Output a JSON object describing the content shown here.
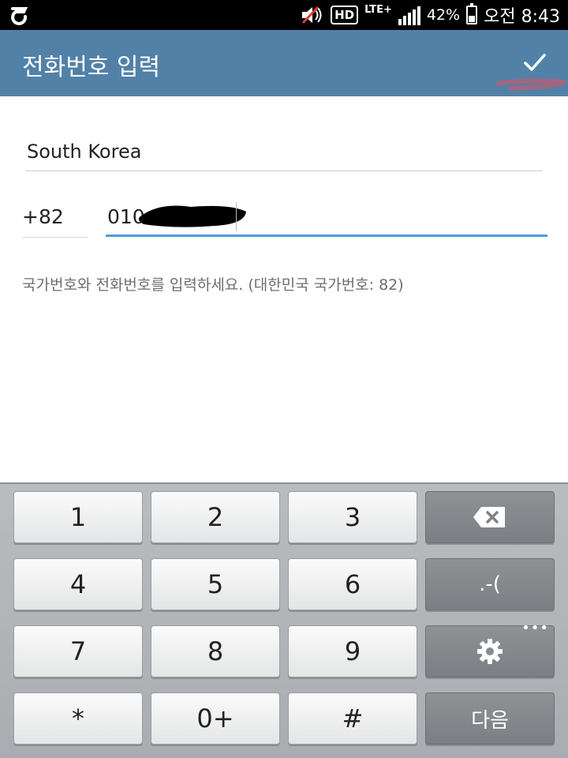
{
  "status_bar": {
    "battery_percent": "42%",
    "network": "LTE+",
    "hd_label": "HD",
    "time": "오전 8:43"
  },
  "app_bar": {
    "title": "전화번호 입력",
    "confirm_icon": "check-icon"
  },
  "form": {
    "country": "South Korea",
    "country_code": "+82",
    "phone_number_visible": "010",
    "hint": "국가번호와 전화번호를 입력하세요. (대한민국 국가번호: 82)"
  },
  "keyboard": {
    "keys": [
      "1",
      "2",
      "3",
      "4",
      "5",
      "6",
      "7",
      "8",
      "9",
      "*",
      "0+",
      "#"
    ],
    "symbols_key": ".-(",
    "next_key": "다음",
    "backspace_icon": "backspace-icon",
    "settings_icon": "gear-icon"
  }
}
